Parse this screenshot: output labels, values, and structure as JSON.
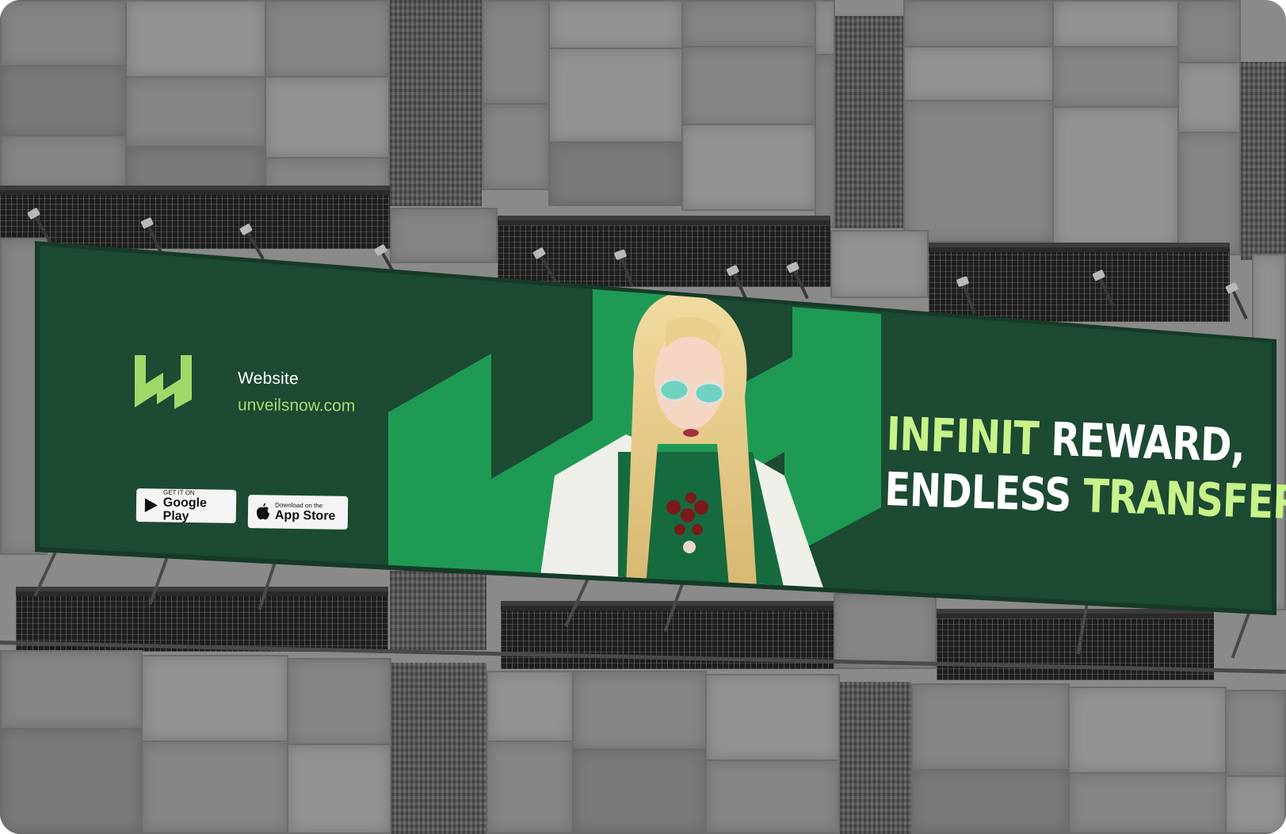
{
  "billboard": {
    "brand_mark": "w-logo-icon",
    "website_label": "Website",
    "website_url": "unveilsnow.com",
    "google_play": {
      "small": "GET IT ON",
      "big": "Google Play",
      "icon": "play-triangle-icon"
    },
    "app_store": {
      "small": "Download on the",
      "big": "App Store",
      "icon": "apple-icon"
    },
    "headline": {
      "line1_accent": "INFINIT",
      "line1_white": " REWARD,",
      "line2_white": "ENDLESS ",
      "line2_accent": "TRANSFER"
    }
  },
  "colors": {
    "banner_bg": "#1c4a32",
    "banner_shape": "#1f9a55",
    "accent_lime": "#c8f28a",
    "url_green": "#a8dc6e",
    "facade_gray": "#858585"
  }
}
